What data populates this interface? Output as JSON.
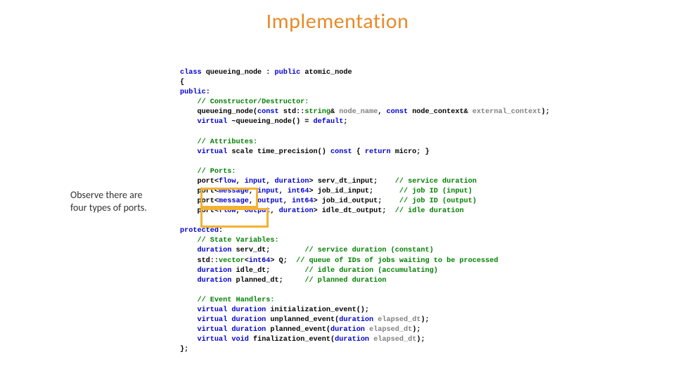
{
  "title": "Implementation",
  "annotation": {
    "line1": "Observe there are",
    "line2": "four types of ports."
  },
  "code": {
    "l01a": "class",
    "l01b": " queueing_node : ",
    "l01c": "public",
    "l01d": " atomic_node",
    "l02a": "{",
    "l03a": "public",
    "l03b": ":",
    "l04a": "    ",
    "l04b": "// Constructor/Destructor:",
    "l05a": "    queueing_node(",
    "l05b": "const",
    "l05c": " std::",
    "l05d": "string",
    "l05e": "& ",
    "l05f": "node_name",
    "l05g": ", ",
    "l05h": "const",
    "l05i": " node_context& ",
    "l05j": "external_context",
    "l05k": ");",
    "l06a": "    ",
    "l06b": "virtual",
    "l06c": " ~queueing_node() = ",
    "l06d": "default",
    "l06e": ";",
    "l07a": " ",
    "l08a": "    ",
    "l08b": "// Attributes:",
    "l09a": "    ",
    "l09b": "virtual",
    "l09c": " scale time_precision() ",
    "l09d": "const",
    "l09e": " { ",
    "l09f": "return",
    "l09g": " micro; }",
    "l10a": " ",
    "l11a": "    ",
    "l11b": "// Ports:",
    "l12a": "    port<",
    "l12b": "flow",
    "l12c": ", ",
    "l12d": "input",
    "l12e": ", ",
    "l12f": "duration",
    "l12g": "> serv_dt_input;    ",
    "l12h": "// service duration",
    "l13a": "    port<",
    "l13b": "message",
    "l13c": ", ",
    "l13d": "input",
    "l13e": ", ",
    "l13f": "int64",
    "l13g": "> job_id_input;      ",
    "l13h": "// job ID (input)",
    "l14a": "    port<",
    "l14b": "message",
    "l14c": ", ",
    "l14d": "output",
    "l14e": ", ",
    "l14f": "int64",
    "l14g": "> job_id_output;    ",
    "l14h": "// job ID (output)",
    "l15a": "    port<",
    "l15b": "flow",
    "l15c": ", ",
    "l15d": "output",
    "l15e": ", ",
    "l15f": "duration",
    "l15g": "> idle_dt_output;  ",
    "l15h": "// idle duration",
    "l16a": " ",
    "l17a": "protected",
    "l17b": ":",
    "l18a": "    ",
    "l18b": "// State Variables:",
    "l19a": "    ",
    "l19b": "duration",
    "l19c": " serv_dt;        ",
    "l19d": "// service duration (constant)",
    "l20a": "    std::",
    "l20b": "vector",
    "l20c": "<",
    "l20d": "int64",
    "l20e": "> Q;  ",
    "l20f": "// queue of IDs of jobs waiting to be processed",
    "l21a": "    ",
    "l21b": "duration",
    "l21c": " idle_dt;        ",
    "l21d": "// idle duration (accumulating)",
    "l22a": "    ",
    "l22b": "duration",
    "l22c": " planned_dt;     ",
    "l22d": "// planned duration",
    "l23a": " ",
    "l24a": "    ",
    "l24b": "// Event Handlers:",
    "l25a": "    ",
    "l25b": "virtual",
    "l25c": " ",
    "l25d": "duration",
    "l25e": " initialization_event();",
    "l26a": "    ",
    "l26b": "virtual",
    "l26c": " ",
    "l26d": "duration",
    "l26e": " unplanned_event(",
    "l26f": "duration",
    "l26g": " ",
    "l26h": "elapsed_dt",
    "l26i": ");",
    "l27a": "    ",
    "l27b": "virtual",
    "l27c": " ",
    "l27d": "duration",
    "l27e": " planned_event(",
    "l27f": "duration",
    "l27g": " ",
    "l27h": "elapsed_dt",
    "l27i": ");",
    "l28a": "    ",
    "l28b": "virtual",
    "l28c": " ",
    "l28d": "void",
    "l28e": " finalization_event(",
    "l28f": "duration",
    "l28g": " ",
    "l28h": "elapsed_dt",
    "l28i": ");",
    "l29a": "};"
  }
}
